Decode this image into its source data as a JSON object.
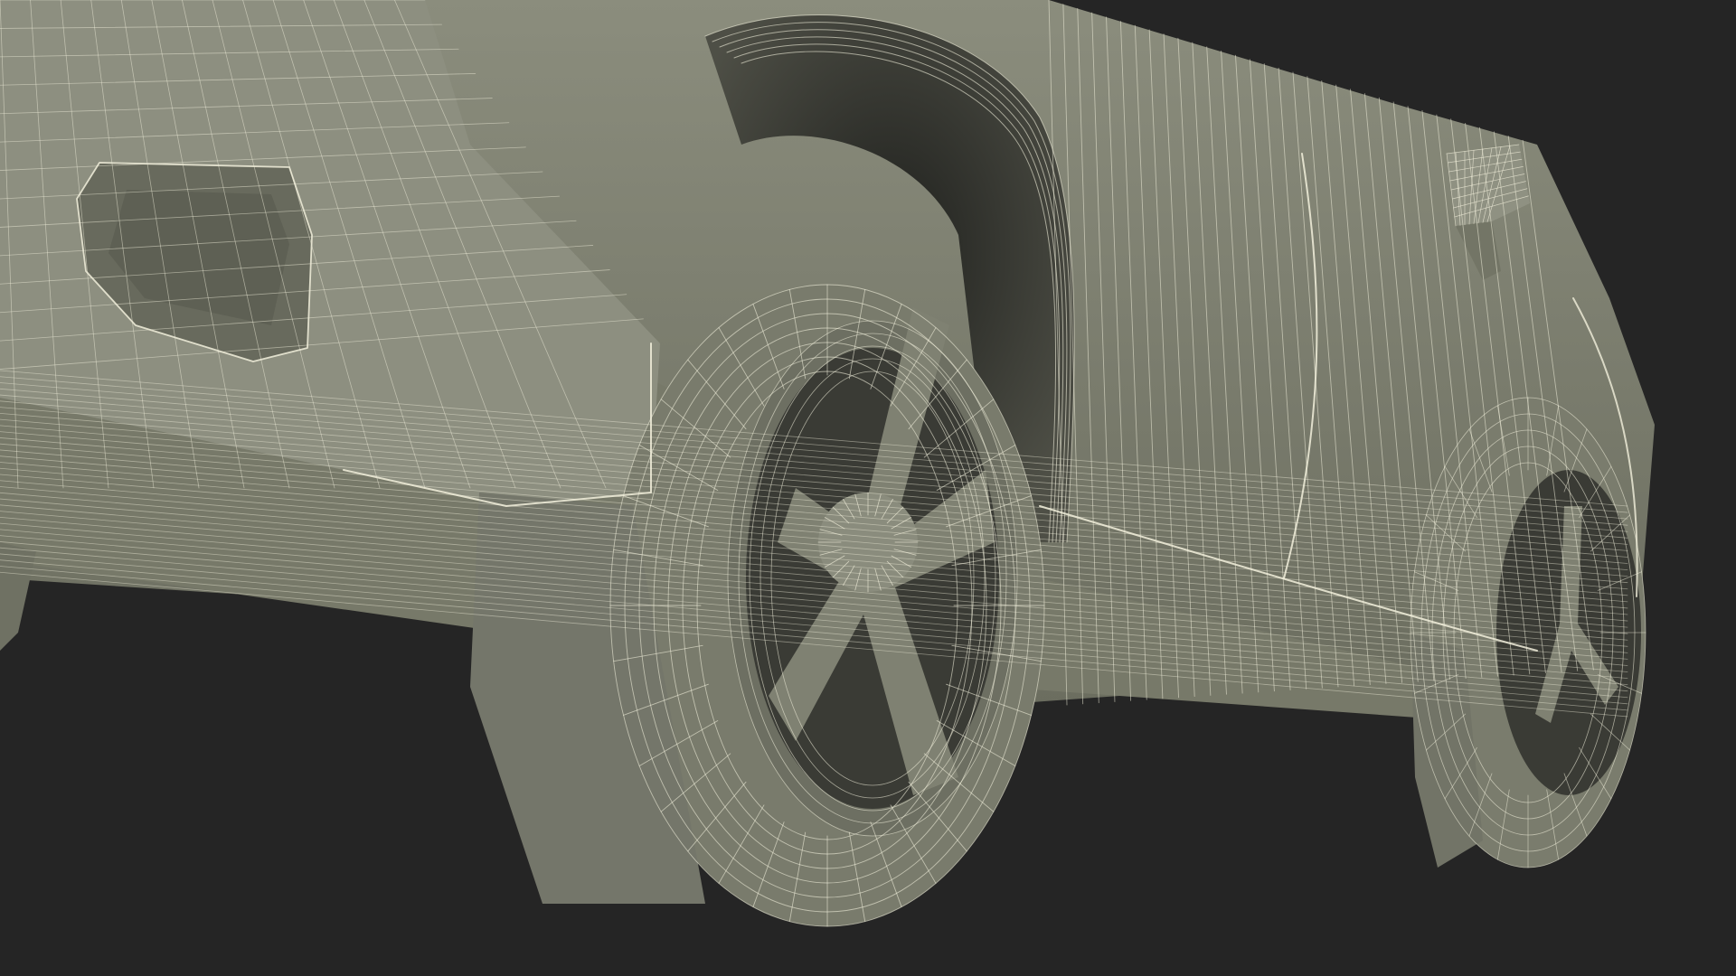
{
  "render": {
    "background_color": "#252525",
    "surface_color": "#7d7f70",
    "surface_shadow_color": "#4a4b42",
    "cavity_color": "#2f302c",
    "wire_color": "#f2f0dc",
    "wire_density": 34
  }
}
